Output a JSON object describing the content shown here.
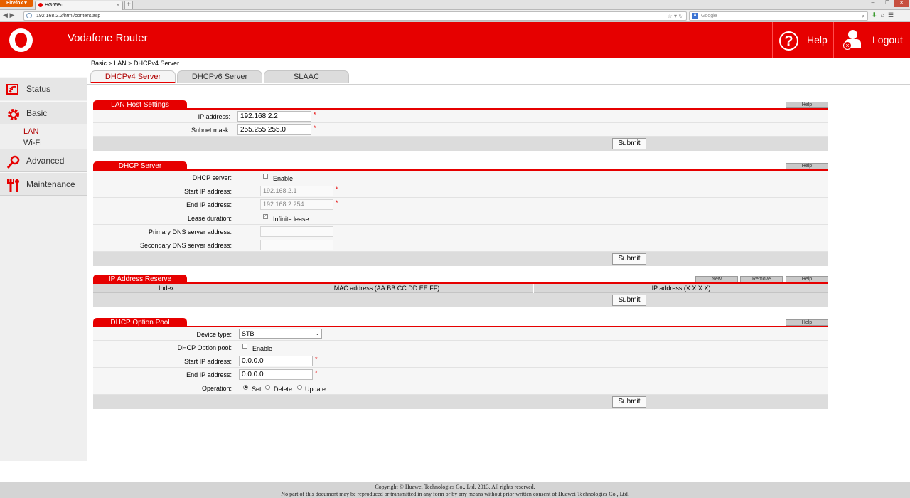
{
  "browser": {
    "menu_label": "Firefox",
    "tab_title": "HG658c",
    "tab_close": "×",
    "new_tab": "+",
    "url": "192.168.2.2/html/content.asp",
    "search_placeholder": "Google",
    "search_engine_letter": "8"
  },
  "header": {
    "title": "Vodafone Router",
    "help_label": "Help",
    "help_icon_glyph": "?",
    "logout_label": "Logout"
  },
  "sidebar": {
    "items": [
      {
        "label": "Status"
      },
      {
        "label": "Basic"
      },
      {
        "label": "Advanced"
      },
      {
        "label": "Maintenance"
      }
    ],
    "sub_items": [
      {
        "label": "LAN",
        "active": true
      },
      {
        "label": "Wi-Fi",
        "active": false
      }
    ]
  },
  "breadcrumb": "Basic > LAN > DHCPv4 Server",
  "page_tabs": [
    {
      "label": "DHCPv4 Server",
      "active": true
    },
    {
      "label": "DHCPv6 Server",
      "active": false
    },
    {
      "label": "SLAAC",
      "active": false
    }
  ],
  "lan_host": {
    "title": "LAN Host Settings",
    "help": "Help",
    "ip_label": "IP address:",
    "ip_value": "192.168.2.2",
    "mask_label": "Subnet mask:",
    "mask_value": "255.255.255.0",
    "required": "*",
    "submit": "Submit"
  },
  "dhcp_server": {
    "title": "DHCP Server",
    "help": "Help",
    "server_label": "DHCP server:",
    "enable_label": "Enable",
    "enable_checked": false,
    "start_label": "Start IP address:",
    "start_value": "192.168.2.1",
    "end_label": "End IP address:",
    "end_value": "192.168.2.254",
    "lease_label": "Lease duration:",
    "infinite_label": "Infinite lease",
    "infinite_checked": true,
    "primary_dns_label": "Primary DNS server address:",
    "primary_dns_value": "",
    "secondary_dns_label": "Secondary DNS server address:",
    "secondary_dns_value": "",
    "required": "*",
    "submit": "Submit"
  },
  "ip_reserve": {
    "title": "IP Address Reserve",
    "new": "New",
    "remove": "Remove",
    "help": "Help",
    "columns": [
      "Index",
      "MAC address:(AA:BB:CC:DD:EE:FF)",
      "IP address:(X.X.X.X)"
    ],
    "rows": [],
    "submit": "Submit"
  },
  "option_pool": {
    "title": "DHCP Option Pool",
    "help": "Help",
    "device_type_label": "Device type:",
    "device_type_value": "STB",
    "pool_label": "DHCP Option pool:",
    "enable_label": "Enable",
    "enable_checked": false,
    "start_label": "Start IP address:",
    "start_value": "0.0.0.0",
    "end_label": "End IP address:",
    "end_value": "0.0.0.0",
    "operation_label": "Operation:",
    "op_set": "Set",
    "op_delete": "Delete",
    "op_update": "Update",
    "operation_selected": "Set",
    "required": "*",
    "submit": "Submit"
  },
  "footer": {
    "line1": "Copyright © Huawei Technologies Co., Ltd. 2013. All rights reserved.",
    "line2": "No part of this document may be reproduced or transmitted in any form or by any means without prior written consent of Huawei Technologies Co., Ltd."
  },
  "colors": {
    "brand_red": "#e60000",
    "active_link": "#b00000"
  }
}
